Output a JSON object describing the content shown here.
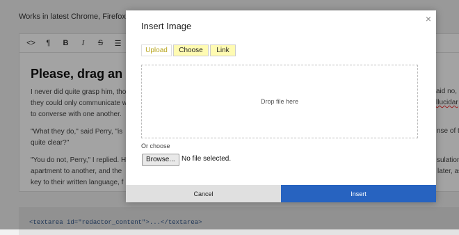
{
  "background": {
    "intro_text": "Works in latest Chrome, Firefox, Op",
    "toolbar_buttons": [
      {
        "name": "html-code-icon",
        "glyph": "<>"
      },
      {
        "name": "paragraph-format-icon",
        "glyph": "¶"
      },
      {
        "name": "bold-icon",
        "glyph": "B"
      },
      {
        "name": "italic-icon",
        "glyph": "I"
      },
      {
        "name": "strikethrough-icon",
        "glyph": "S"
      },
      {
        "name": "unordered-list-icon",
        "glyph": "☰"
      },
      {
        "name": "ordered-list-icon",
        "glyph": "☷"
      }
    ],
    "heading": "Please, drag an i",
    "paragraphs": [
      {
        "lines": [
          {
            "text": "I never did quite grasp him, tho",
            "right": "said no,"
          },
          {
            "text": "they could only communicate w",
            "right": "llucidar"
          },
          {
            "text": "to converse with one another.",
            "right": ""
          }
        ]
      },
      {
        "lines": [
          {
            "text": "\"What they do,\" said Perry, \"is",
            "right": "nse of t"
          },
          {
            "text": "quite clear?\"",
            "right": ""
          }
        ]
      },
      {
        "lines": [
          {
            "text": "\"You do not, Perry,\" I replied. H",
            "right": "sulation"
          },
          {
            "text": "apartment to another, and the",
            "right": "later, as"
          },
          {
            "text": "key to their written language, f",
            "right": ""
          }
        ]
      }
    ],
    "code_snippet": "<textarea id=\"redactor_content\">...</textarea>"
  },
  "modal": {
    "title": "Insert Image",
    "close_glyph": "×",
    "tabs": [
      {
        "label": "Upload",
        "active": true
      },
      {
        "label": "Choose",
        "active": false
      },
      {
        "label": "Link",
        "active": false
      }
    ],
    "dropzone_text": "Drop file here",
    "or_choose_label": "Or choose",
    "file_button_label": "Browse...",
    "file_status": "No file selected.",
    "cancel_label": "Cancel",
    "insert_label": "Insert"
  },
  "colors": {
    "insert_button": "#2763c0",
    "tab_highlight": "#fffbb2",
    "code_text": "#35588a"
  }
}
